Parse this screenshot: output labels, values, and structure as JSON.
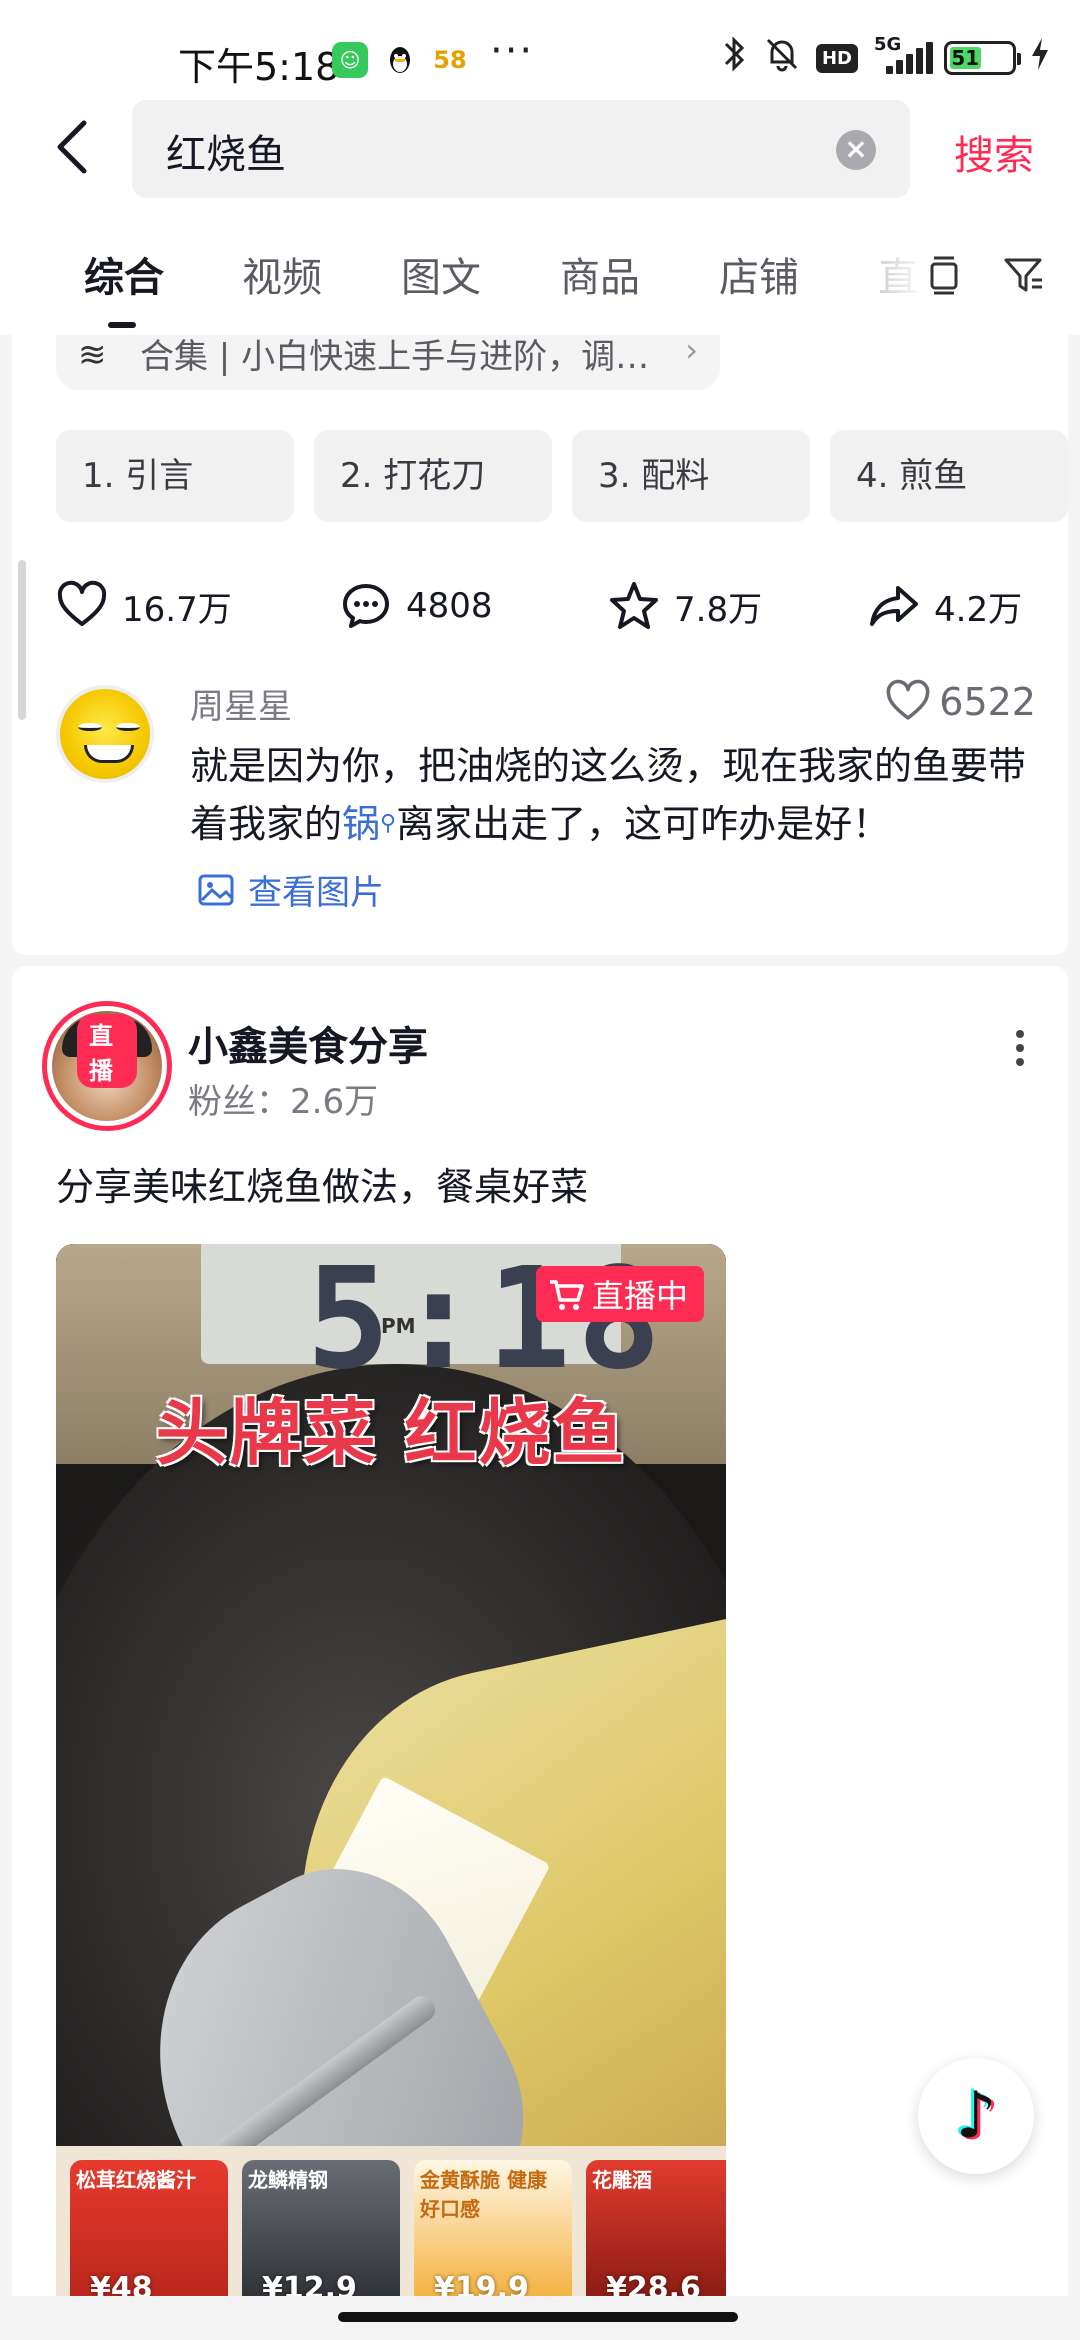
{
  "status_bar": {
    "time": "下午5:18",
    "network": "5G",
    "hd": "HD",
    "battery": "51",
    "more": "···"
  },
  "search": {
    "query": "红烧鱼",
    "submit_label": "搜索"
  },
  "tabs": [
    {
      "label": "综合",
      "active": true
    },
    {
      "label": "视频"
    },
    {
      "label": "图文"
    },
    {
      "label": "商品"
    },
    {
      "label": "店铺"
    },
    {
      "label": "直"
    }
  ],
  "result1": {
    "collection_text": "合集 | 小白快速上手与进阶，调…",
    "chapters": [
      "1. 引言",
      "2. 打花刀",
      "3. 配料",
      "4. 煎鱼"
    ],
    "stats": {
      "likes": "16.7万",
      "comments": "4808",
      "favorites": "7.8万",
      "shares": "4.2万"
    },
    "top_comment": {
      "user": "周星星",
      "likes": "6522",
      "text_before": " 就是因为你，把油烧的这么烫，现在我家的鱼要带着我家的",
      "link_word": "锅",
      "text_after": "离家出走了，这可咋办是好！",
      "view_image_label": "查看图片"
    }
  },
  "result2": {
    "avatar_badge": "直播",
    "author": "小鑫美食分享",
    "fans": "粉丝：2.6万",
    "description": "分享美味红烧鱼做法，餐桌好菜",
    "video": {
      "overlay_title": "头牌菜 红烧鱼",
      "clock_digits": "5:18",
      "clock_pm": "PM",
      "live_tag": "直播中"
    },
    "products": [
      {
        "top": "松茸红烧酱汁",
        "price": "¥48"
      },
      {
        "top": "龙鳞精钢",
        "price": "¥12.9"
      },
      {
        "top": "金黄酥脆 健康好口感",
        "price": "¥19.9"
      },
      {
        "top": "花雕酒",
        "price": "¥28.6"
      }
    ]
  },
  "colors": {
    "accent": "#fe2c55",
    "link": "#3a6fd8",
    "text": "#161823",
    "secondary": "#7a7b82"
  }
}
